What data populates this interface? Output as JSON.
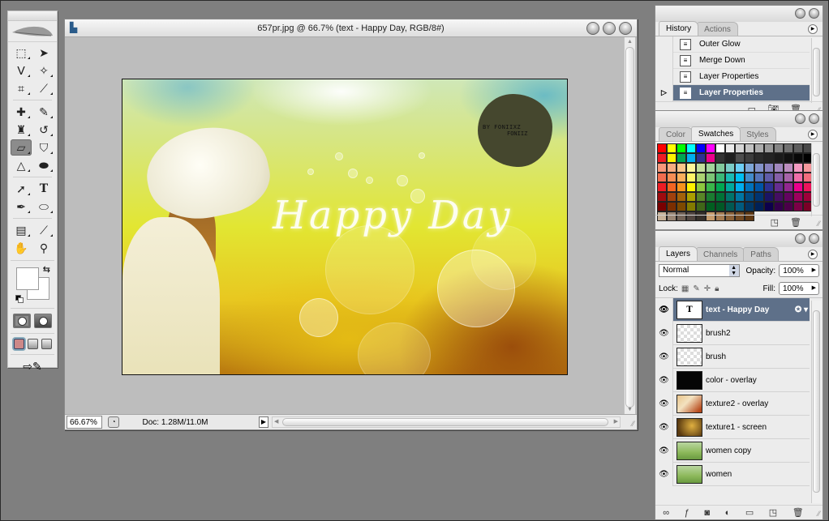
{
  "toolbox": {
    "tools": [
      {
        "name": "rectangular-marquee",
        "glyph": "⬚",
        "active": false
      },
      {
        "name": "move",
        "glyph": "➤",
        "active": false
      },
      {
        "name": "polygonal-lasso",
        "glyph": "ᐯ",
        "active": false
      },
      {
        "name": "magic-wand",
        "glyph": "✧",
        "active": false
      },
      {
        "name": "crop",
        "glyph": "⌗",
        "active": false
      },
      {
        "name": "slice",
        "glyph": "⟋",
        "active": false
      },
      {
        "name": "healing-brush",
        "glyph": "✚",
        "active": false
      },
      {
        "name": "brush",
        "glyph": "✎",
        "active": false
      },
      {
        "name": "clone-stamp",
        "glyph": "♜",
        "active": false
      },
      {
        "name": "history-brush",
        "glyph": "↺",
        "active": false
      },
      {
        "name": "eraser",
        "glyph": "▱",
        "active": true
      },
      {
        "name": "paint-bucket",
        "glyph": "⛉",
        "active": false
      },
      {
        "name": "blur",
        "glyph": "△",
        "active": false
      },
      {
        "name": "dodge",
        "glyph": "⬬",
        "active": false
      },
      {
        "name": "path-selection",
        "glyph": "➚",
        "active": false
      },
      {
        "name": "type",
        "glyph": "T",
        "active": false
      },
      {
        "name": "pen",
        "glyph": "✒",
        "active": false
      },
      {
        "name": "ellipse",
        "glyph": "⬭",
        "active": false
      },
      {
        "name": "notes",
        "glyph": "▤",
        "active": false
      },
      {
        "name": "eyedropper",
        "glyph": "⟋",
        "active": false
      },
      {
        "name": "hand",
        "glyph": "✋",
        "active": false
      },
      {
        "name": "zoom",
        "glyph": "⚲",
        "active": false
      }
    ],
    "foreground_color": "#ffffff",
    "background_color": "#ffffff"
  },
  "document": {
    "title": "657pr.jpg @ 66.7% (text - Happy Day, RGB/8#)",
    "zoom": "66.67%",
    "doc_info": "Doc: 1.28M/11.0M",
    "artwork": {
      "main_text": "Happy Day",
      "watermark_line1": "BY FONIIXZ",
      "watermark_line2": "FONIIZ"
    }
  },
  "history": {
    "tabs": [
      "History",
      "Actions"
    ],
    "active_tab": 0,
    "items": [
      {
        "label": "Outer Glow",
        "selected": false
      },
      {
        "label": "Merge Down",
        "selected": false
      },
      {
        "label": "Layer Properties",
        "selected": false
      },
      {
        "label": "Layer Properties",
        "selected": true
      }
    ]
  },
  "swatches": {
    "tabs": [
      "Color",
      "Swatches",
      "Styles"
    ],
    "active_tab": 1,
    "colors": [
      "#ff0000",
      "#ffff00",
      "#00ff00",
      "#00ffff",
      "#0000ff",
      "#ff00ff",
      "#ffffff",
      "#ebebeb",
      "#d6d6d6",
      "#c2c2c2",
      "#adadad",
      "#999999",
      "#858585",
      "#707070",
      "#5c5c5c",
      "#474747",
      "#ed1c24",
      "#fff200",
      "#00a651",
      "#00aeef",
      "#2e3192",
      "#ec008c",
      "#333333",
      "#1f1f1f",
      "#4d4d4d",
      "#3d3d3d",
      "#2b2b2b",
      "#232323",
      "#1a1a1a",
      "#111111",
      "#080808",
      "#000000",
      "#f7977a",
      "#f9ad81",
      "#fdc68a",
      "#fff79a",
      "#c4df9b",
      "#a3d39c",
      "#82ca9d",
      "#7bcdc8",
      "#6ecff6",
      "#7ea7d8",
      "#8493ca",
      "#8882be",
      "#a187be",
      "#bc8dbf",
      "#f49ac2",
      "#f6989d",
      "#f26c4f",
      "#f68e55",
      "#fbaf5c",
      "#fff467",
      "#acd372",
      "#7cc576",
      "#3bb878",
      "#1abbb4",
      "#00bff3",
      "#438ccb",
      "#5574b9",
      "#605ca8",
      "#855fa8",
      "#a763a8",
      "#f06ea9",
      "#f26d7d",
      "#ed1c24",
      "#f26522",
      "#f7941d",
      "#fff200",
      "#8dc73f",
      "#39b54a",
      "#00a651",
      "#00a99d",
      "#00aeef",
      "#0072bc",
      "#0054a6",
      "#2e3192",
      "#662d91",
      "#92278f",
      "#ec008c",
      "#ed145b",
      "#9e0b0f",
      "#a0410d",
      "#a3620a",
      "#aba000",
      "#598527",
      "#1a7b30",
      "#007236",
      "#00746b",
      "#0076a3",
      "#004b80",
      "#003471",
      "#1b1464",
      "#440e62",
      "#630460",
      "#9e005d",
      "#9e0039",
      "#790000",
      "#7b2e00",
      "#7d4900",
      "#827b00",
      "#406618",
      "#005e20",
      "#005826",
      "#005952",
      "#005b7f",
      "#003663",
      "#002157",
      "#0d004c",
      "#32004b",
      "#4b0049",
      "#7b0046",
      "#7a0026",
      "#c7b299",
      "#998675",
      "#736357",
      "#534741",
      "#37302a",
      "#c69c6d",
      "#a67c52",
      "#8c6239",
      "#754c24",
      "#603913"
    ]
  },
  "layers": {
    "tabs": [
      "Layers",
      "Channels",
      "Paths"
    ],
    "active_tab": 0,
    "blend_mode": "Normal",
    "opacity_label": "Opacity:",
    "opacity": "100%",
    "lock_label": "Lock:",
    "fill_label": "Fill:",
    "fill": "100%",
    "items": [
      {
        "name": "text - Happy Day",
        "thumb": "text",
        "visible": true,
        "selected": true,
        "fx": true
      },
      {
        "name": "brush2",
        "thumb": "transparent",
        "visible": true,
        "selected": false,
        "fx": false
      },
      {
        "name": "brush",
        "thumb": "transparent",
        "visible": true,
        "selected": false,
        "fx": false
      },
      {
        "name": "color - overlay",
        "thumb": "black",
        "visible": true,
        "selected": false,
        "fx": false
      },
      {
        "name": "texture2 - overlay",
        "thumb": "texture2",
        "visible": true,
        "selected": false,
        "fx": false
      },
      {
        "name": "texture1 - screen",
        "thumb": "texture1",
        "visible": true,
        "selected": false,
        "fx": false
      },
      {
        "name": "women copy",
        "thumb": "photo",
        "visible": true,
        "selected": false,
        "fx": false
      },
      {
        "name": "women",
        "thumb": "photo",
        "visible": true,
        "selected": false,
        "fx": false
      }
    ]
  }
}
